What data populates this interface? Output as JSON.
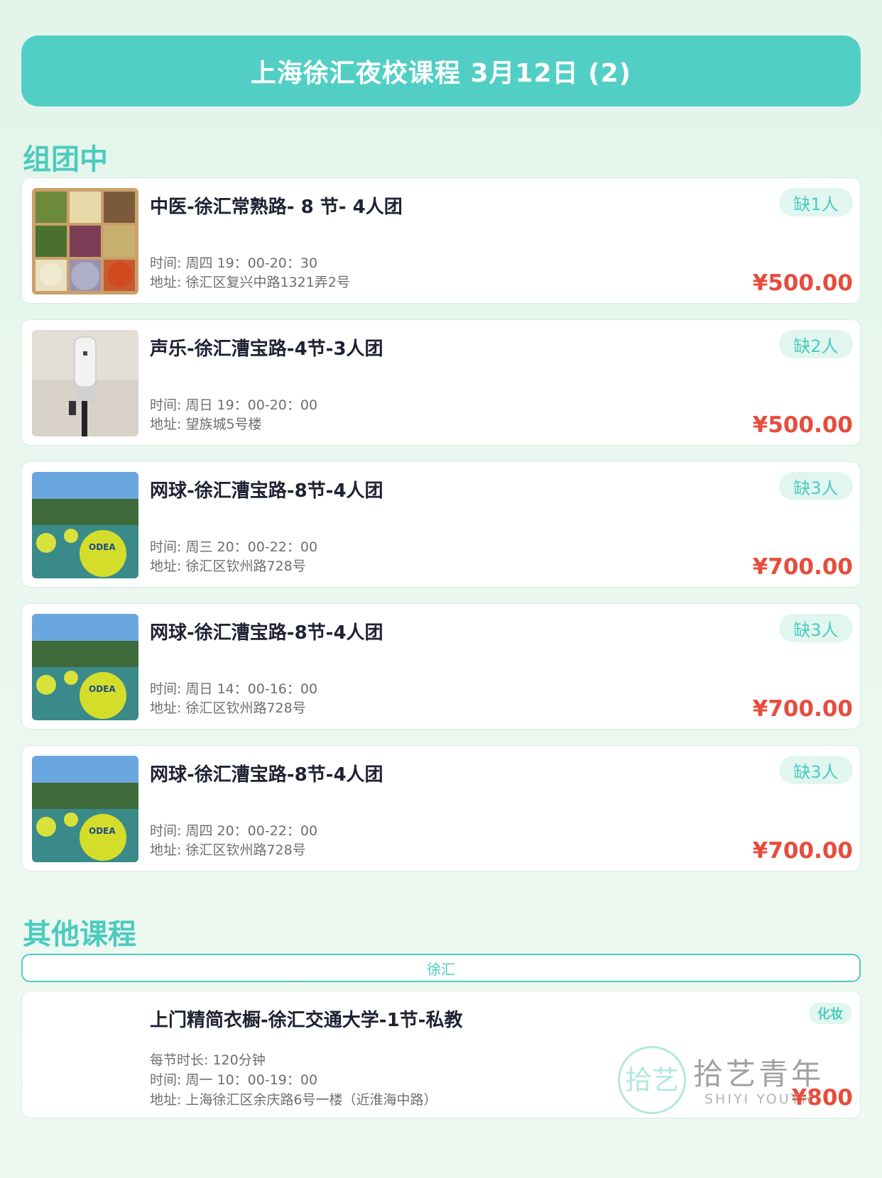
{
  "header": {
    "title": "上海徐汇夜校课程 3月12日 (2)"
  },
  "group_section": {
    "title": "组团中"
  },
  "courses": [
    {
      "title": "中医-徐汇常熟路- 8 节- 4人团",
      "time": "时间: 周四 19：00-20：30",
      "address": "地址: 徐汇区复兴中路1321弄2号",
      "badge": "缺1人",
      "price": "¥500.00",
      "image": "herbs"
    },
    {
      "title": "声乐-徐汇漕宝路-4节-3人团",
      "time": "时间: 周日 19：00-20：00",
      "address": "地址: 望族城5号楼",
      "badge": "缺2人",
      "price": "¥500.00",
      "image": "microphone"
    },
    {
      "title": "网球-徐汇漕宝路-8节-4人团",
      "time": "时间: 周三 20：00-22：00",
      "address": "地址: 徐汇区钦州路728号",
      "badge": "缺3人",
      "price": "¥700.00",
      "image": "tennis"
    },
    {
      "title": "网球-徐汇漕宝路-8节-4人团",
      "time": "时间: 周日 14：00-16：00",
      "address": "地址: 徐汇区钦州路728号",
      "badge": "缺3人",
      "price": "¥700.00",
      "image": "tennis"
    },
    {
      "title": "网球-徐汇漕宝路-8节-4人团",
      "time": "时间: 周四 20：00-22：00",
      "address": "地址: 徐汇区钦州路728号",
      "badge": "缺3人",
      "price": "¥700.00",
      "image": "tennis"
    }
  ],
  "other_section": {
    "title": "其他课程",
    "filter_tab": "徐汇",
    "course": {
      "title": "上门精简衣橱-徐汇交通大学-1节-私教",
      "duration": "每节时长: 120分钟",
      "time": "时间: 周一 10：00-19：00",
      "address": "地址: 上海徐汇区余庆路6号一楼（近淮海中路）",
      "tag": "化妆",
      "price": "¥800"
    }
  },
  "watermark": {
    "logo_char": "拾艺",
    "cn": "拾艺青年",
    "en": "SHIYI YOUTH"
  },
  "colors": {
    "accent": "#52cfc4",
    "price": "#e74c3c",
    "badge_bg": "#e1f6ef"
  }
}
